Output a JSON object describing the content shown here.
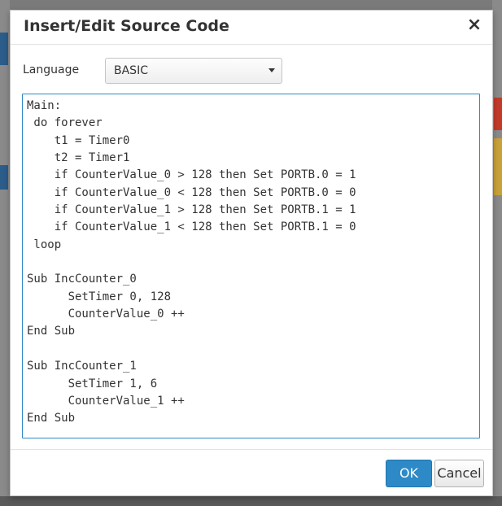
{
  "dialog": {
    "title": "Insert/Edit Source Code",
    "close_glyph": "×",
    "close_icon": "close-icon"
  },
  "language": {
    "label": "Language",
    "selected": "BASIC"
  },
  "code_lines": [
    "Main:",
    " do forever",
    "    t1 = Timer0",
    "    t2 = Timer1",
    "    if CounterValue_0 > 128 then Set PORTB.0 = 1",
    "    if CounterValue_0 < 128 then Set PORTB.0 = 0",
    "    if CounterValue_1 > 128 then Set PORTB.1 = 1",
    "    if CounterValue_1 < 128 then Set PORTB.1 = 0",
    " loop",
    "",
    "Sub IncCounter_0",
    "      SetTimer 0, 128",
    "      CounterValue_0 ++",
    "End Sub",
    "",
    "Sub IncCounter_1",
    "      SetTimer 1, 6",
    "      CounterValue_1 ++",
    "End Sub"
  ],
  "footer": {
    "ok_label": "OK",
    "cancel_label": "Cancel"
  }
}
